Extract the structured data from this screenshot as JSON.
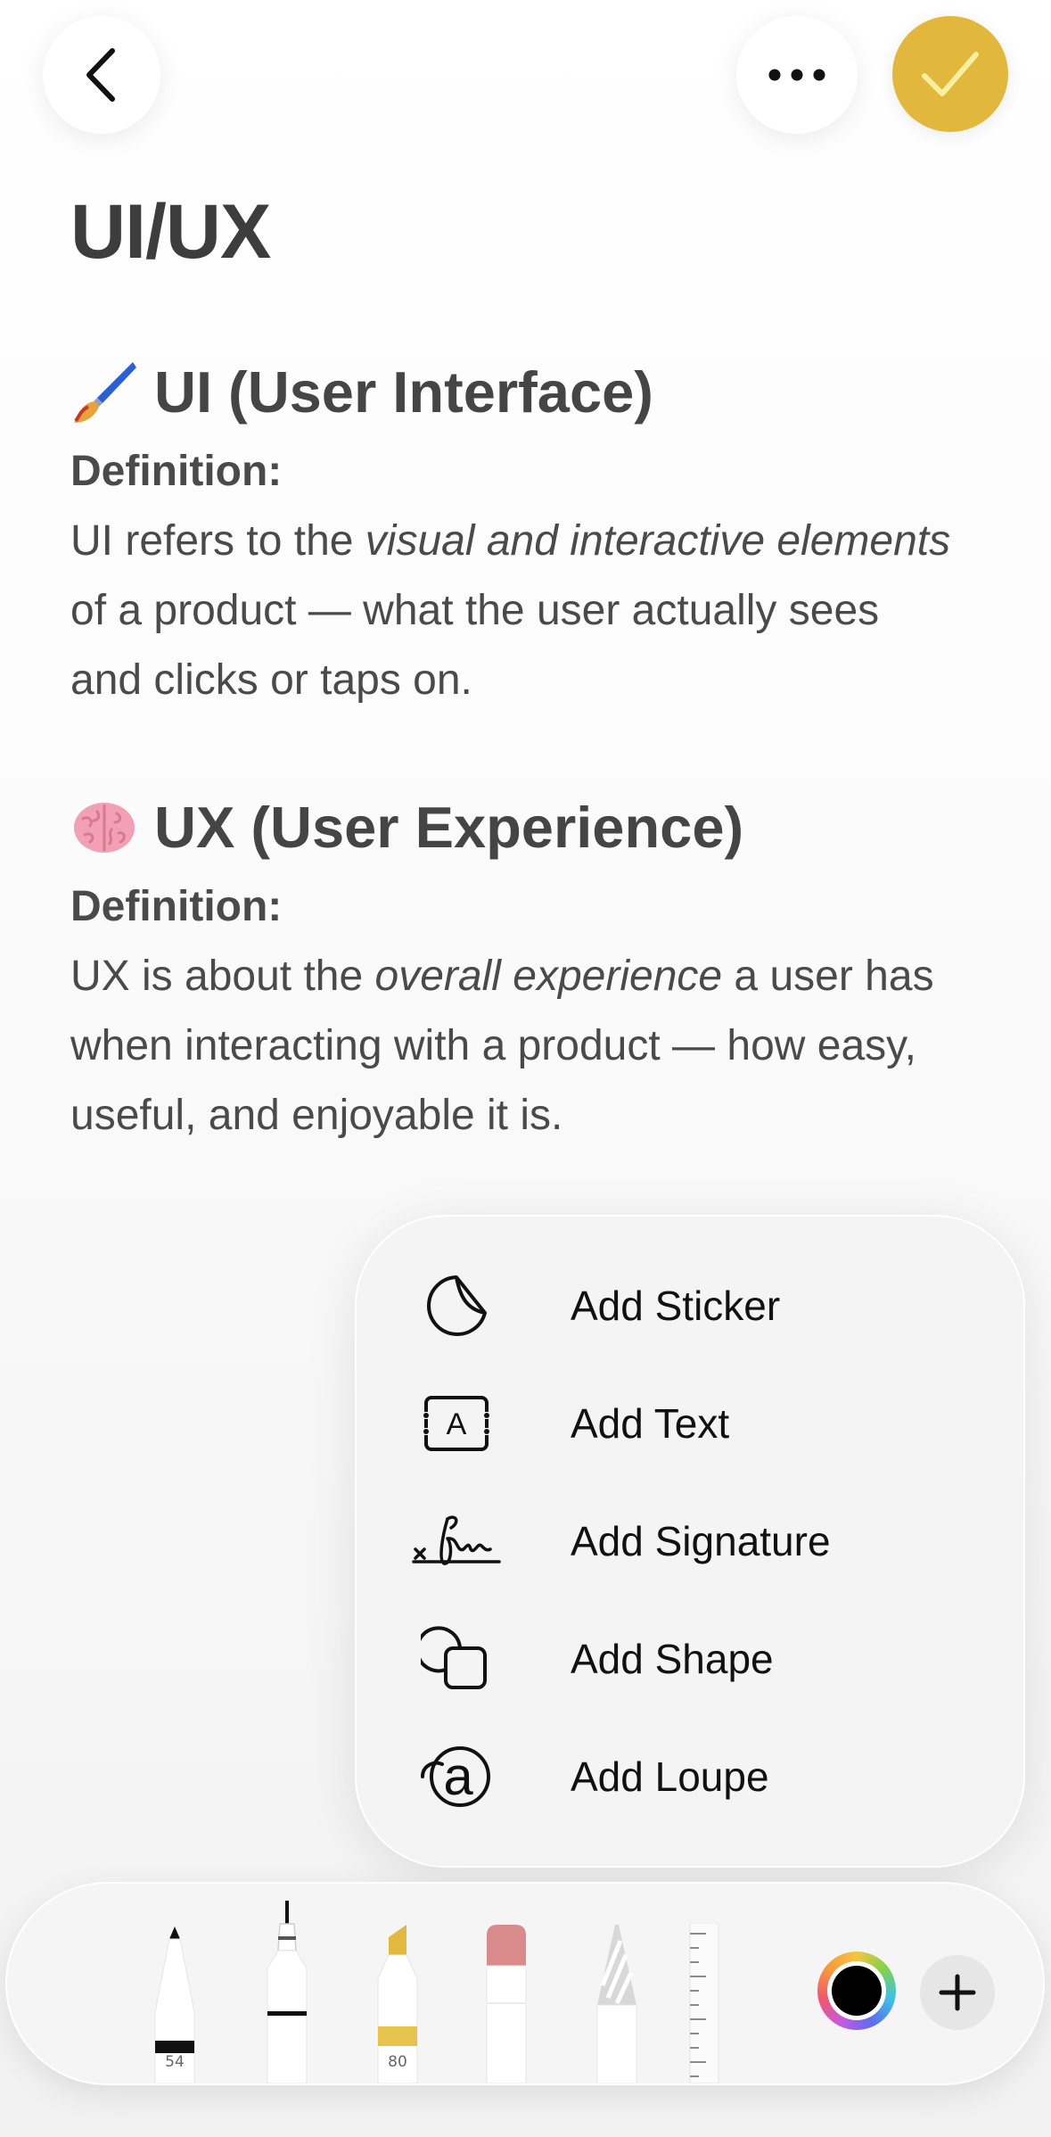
{
  "toolbar": {
    "back_icon": "chevron-left-icon",
    "more_icon": "ellipsis-icon",
    "done_icon": "checkmark-icon",
    "accent_color": "#e1b73c"
  },
  "note": {
    "title": "UI/UX",
    "sections": [
      {
        "emoji": "paintbrush-icon",
        "heading": "UI (User Interface)",
        "definition_label": "Definition:",
        "text_before": "UI refers to the ",
        "text_italic": "visual and interactive elements",
        "text_after": " of a product — what the user actually sees and clicks or taps on."
      },
      {
        "emoji": "brain-icon",
        "heading": "UX (User Experience)",
        "definition_label": "Definition:",
        "text_before": "UX is about the ",
        "text_italic": "overall experience",
        "text_after": " a user has when interacting with a product — how easy, useful, and enjoyable it is."
      }
    ]
  },
  "add_menu": {
    "items": [
      {
        "label": "Add Sticker",
        "icon": "sticker-icon"
      },
      {
        "label": "Add Text",
        "icon": "text-box-icon"
      },
      {
        "label": "Add Signature",
        "icon": "signature-icon"
      },
      {
        "label": "Add Shape",
        "icon": "shapes-icon"
      },
      {
        "label": "Add Loupe",
        "icon": "loupe-icon"
      }
    ]
  },
  "tools": {
    "pen_size": "54",
    "marker_size": "80",
    "selected_color": "#000000",
    "items": [
      "pen-tool",
      "fineliner-tool",
      "marker-tool",
      "eraser-tool",
      "pencil-tool",
      "ruler-tool"
    ]
  }
}
